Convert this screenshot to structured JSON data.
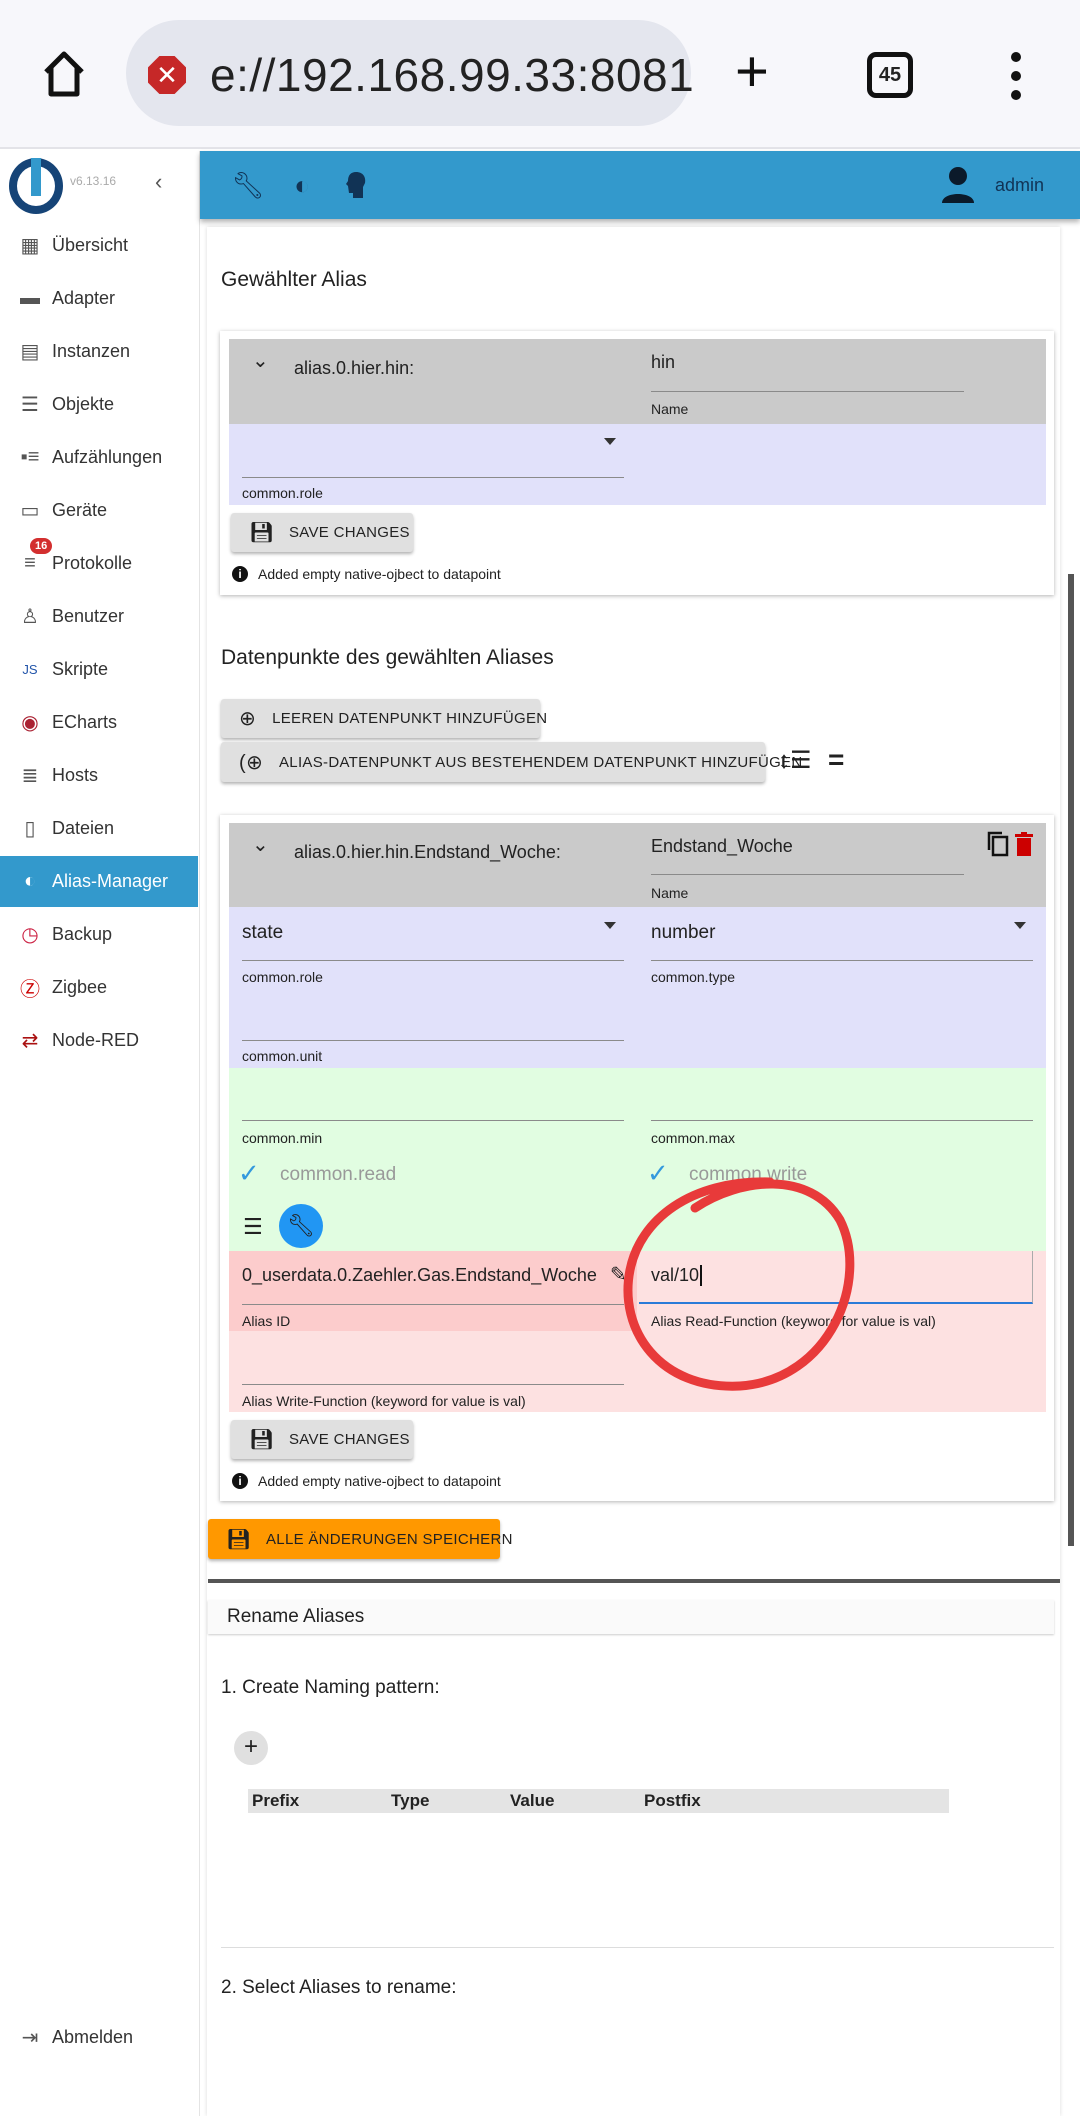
{
  "browser": {
    "url": "e://192.168.99.33:8081",
    "tab_count": "45"
  },
  "sidebar": {
    "version": "v6.13.16",
    "items": [
      {
        "label": "Übersicht",
        "icon": "grid-icon"
      },
      {
        "label": "Adapter",
        "icon": "store-icon"
      },
      {
        "label": "Instanzen",
        "icon": "instances-icon"
      },
      {
        "label": "Objekte",
        "icon": "list-icon"
      },
      {
        "label": "Aufzählungen",
        "icon": "enum-icon"
      },
      {
        "label": "Geräte",
        "icon": "devices-icon"
      },
      {
        "label": "Protokolle",
        "icon": "log-icon",
        "badge": "16"
      },
      {
        "label": "Benutzer",
        "icon": "user-icon"
      },
      {
        "label": "Skripte",
        "icon": "js-icon"
      },
      {
        "label": "ECharts",
        "icon": "echarts-icon"
      },
      {
        "label": "Hosts",
        "icon": "hosts-icon"
      },
      {
        "label": "Dateien",
        "icon": "file-icon"
      },
      {
        "label": "Alias-Manager",
        "icon": "alias-icon",
        "selected": true
      },
      {
        "label": "Backup",
        "icon": "backup-icon"
      },
      {
        "label": "Zigbee",
        "icon": "zigbee-icon"
      },
      {
        "label": "Node-RED",
        "icon": "nodered-icon"
      }
    ],
    "logout": "Abmelden"
  },
  "appbar": {
    "user": "admin",
    "accent": "#3399cc"
  },
  "selected_alias": {
    "heading": "Gewählter Alias",
    "id": "alias.0.hier.hin:",
    "name_value": "hin",
    "name_label": "Name",
    "role_value": "",
    "role_label": "common.role",
    "save_label": "SAVE CHANGES",
    "info": "Added empty native-ojbect to datapoint"
  },
  "datapoints": {
    "heading": "Datenpunkte des gewählten Aliases",
    "add_empty": "LEEREN DATENPUNKT HINZUFÜGEN",
    "add_existing": "ALIAS-DATENPUNKT AUS BESTEHENDEM DATENPUNKT HINZUFÜGEN",
    "dp": {
      "id": "alias.0.hier.hin.Endstand_Woche:",
      "name_value": "Endstand_Woche",
      "name_label": "Name",
      "role_value": "state",
      "role_label": "common.role",
      "type_value": "number",
      "type_label": "common.type",
      "unit_label": "common.unit",
      "min_label": "common.min",
      "max_label": "common.max",
      "read_label": "common.read",
      "write_label": "common.write",
      "alias_id_value": "0_userdata.0.Zaehler.Gas.Endstand_Woche",
      "alias_id_label": "Alias ID",
      "read_fn_value": "val/10",
      "read_fn_label": "Alias Read-Function (keyword for value is val)",
      "write_fn_label": "Alias Write-Function (keyword for value is val)",
      "save_label": "SAVE CHANGES",
      "info": "Added empty native-ojbect to datapoint"
    },
    "save_all": "ALLE ÄNDERUNGEN SPEICHERN"
  },
  "rename": {
    "title": "Rename Aliases",
    "step1": "1. Create Naming pattern:",
    "columns": [
      "Prefix",
      "Type",
      "Value",
      "Postfix"
    ],
    "step2": "2. Select Aliases to rename:"
  }
}
